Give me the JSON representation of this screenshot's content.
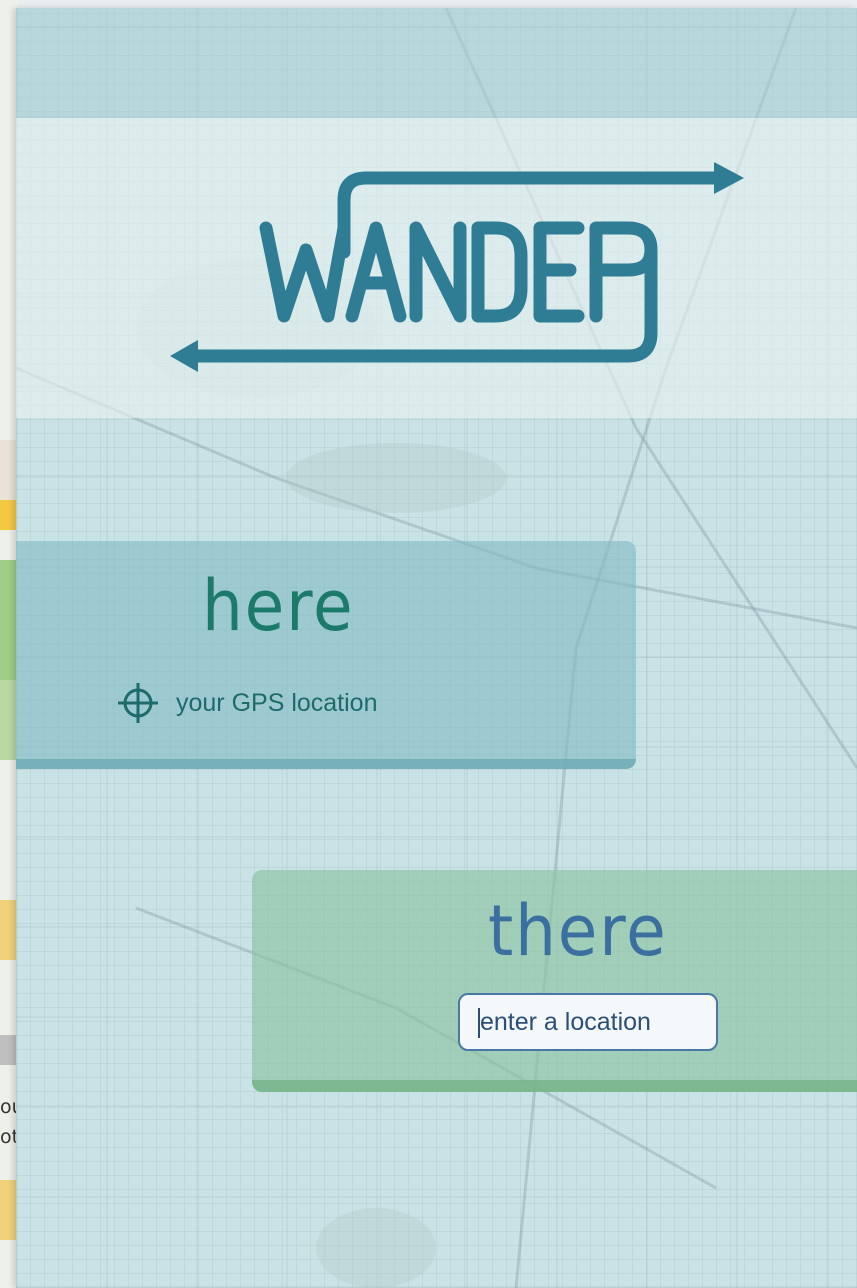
{
  "app": {
    "logo_text": "WANDER"
  },
  "here": {
    "title": "here",
    "gps_label": "your GPS location",
    "icon": "crosshair-icon"
  },
  "there": {
    "title": "there",
    "input_placeholder": "enter a location",
    "input_value": ""
  },
  "background_app": {
    "text_fragments": [
      "ou",
      "otl"
    ]
  },
  "colors": {
    "logo_teal": "#2f7d94",
    "here_text": "#1b7a6a",
    "there_text": "#3a6fa0",
    "here_card": "#82b9c4",
    "there_card": "#8cc3a0"
  }
}
